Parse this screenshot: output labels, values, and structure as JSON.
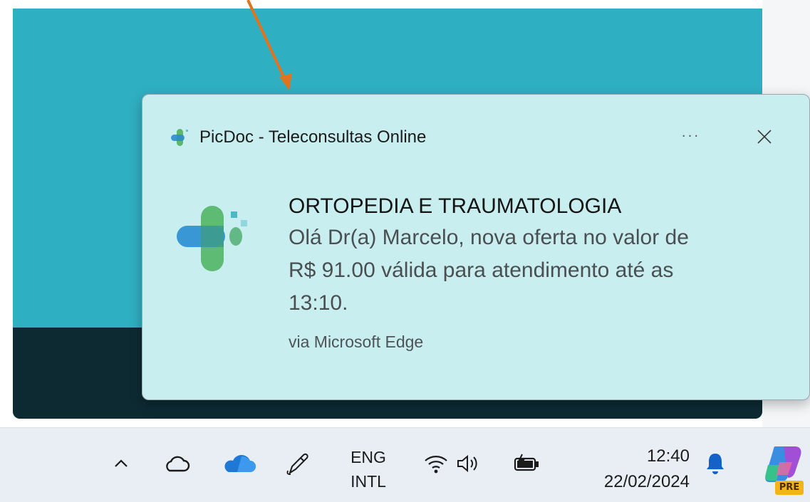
{
  "notification": {
    "app_name": "PicDoc - Teleconsultas Online",
    "more_label": "···",
    "title": "ORTOPEDIA E TRAUMATOLOGIA",
    "message_lines": [
      "Olá Dr(a) Marcelo, nova oferta no valor de",
      "R$ 91.00 válida para atendimento até as",
      "13:10."
    ],
    "attribution": "via Microsoft Edge",
    "logo_icon": "picdoc-cross-logo",
    "close_icon": "close-icon"
  },
  "taskbar": {
    "icons": [
      "chevron-up-icon",
      "cloud-icon",
      "onedrive-icon",
      "pen-icon",
      "wifi-icon",
      "volume-icon",
      "battery-icon",
      "bell-icon",
      "copilot-icon"
    ],
    "language_line1": "ENG",
    "language_line2": "INTL",
    "time": "12:40",
    "date": "22/02/2024",
    "copilot_badge": "PRE"
  },
  "colors": {
    "app_window": "#2fb0c2",
    "app_window_footer": "#0d2a33",
    "toast_background": "#c9eef0",
    "taskbar": "#e9eef5",
    "arrow": "#e0741e"
  }
}
